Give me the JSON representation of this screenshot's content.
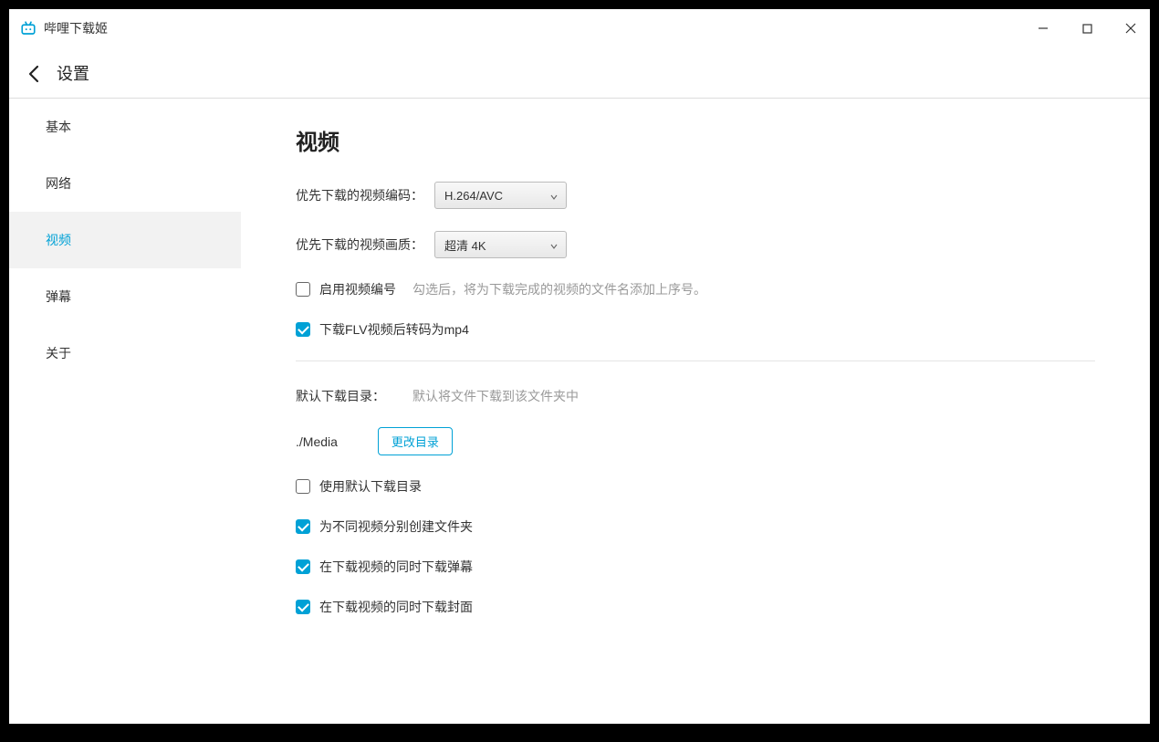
{
  "app": {
    "title": "哔哩下载姬"
  },
  "header": {
    "title": "设置"
  },
  "sidebar": {
    "items": [
      {
        "label": "基本"
      },
      {
        "label": "网络"
      },
      {
        "label": "视频"
      },
      {
        "label": "弹幕"
      },
      {
        "label": "关于"
      }
    ]
  },
  "content": {
    "section_title": "视频",
    "codec_label": "优先下载的视频编码：",
    "codec_value": "H.264/AVC",
    "quality_label": "优先下载的视频画质：",
    "quality_value": "超清 4K",
    "enable_number_label": "启用视频编号",
    "enable_number_hint": "勾选后，将为下载完成的视频的文件名添加上序号。",
    "flv_to_mp4_label": "下载FLV视频后转码为mp4",
    "default_dir_label": "默认下载目录：",
    "default_dir_hint": "默认将文件下载到该文件夹中",
    "path": "./Media",
    "change_dir_button": "更改目录",
    "use_default_dir_label": "使用默认下载目录",
    "create_folders_label": "为不同视频分别创建文件夹",
    "dl_danmaku_label": "在下载视频的同时下载弹幕",
    "dl_cover_label": "在下载视频的同时下载封面"
  }
}
